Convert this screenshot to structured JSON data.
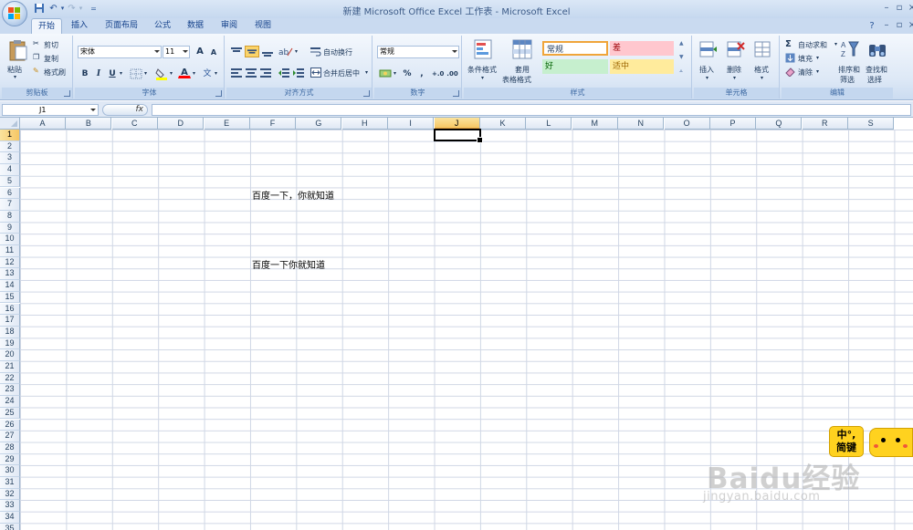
{
  "window": {
    "title": "新建 Microsoft Office Excel 工作表 - Microsoft Excel",
    "qat_customize_label": "="
  },
  "tabs": [
    "开始",
    "插入",
    "页面布局",
    "公式",
    "数据",
    "审阅",
    "视图"
  ],
  "ribbon": {
    "clipboard": {
      "label": "剪贴板",
      "paste": "粘贴",
      "cut": "剪切",
      "copy": "复制",
      "format_painter": "格式刷"
    },
    "font": {
      "label": "字体",
      "font_name": "宋体",
      "font_size": "11",
      "grow": "A",
      "shrink": "A",
      "bold": "B",
      "italic": "I",
      "underline": "U",
      "font_color_letter": "A",
      "phonetic": "文"
    },
    "alignment": {
      "label": "对齐方式",
      "wrap_text": "自动换行",
      "merge_center": "合并后居中"
    },
    "number": {
      "label": "数字",
      "format": "常规",
      "percent": "%",
      "comma": ",",
      "inc_decimal": "+.0",
      "dec_decimal": ".00"
    },
    "styles": {
      "label": "样式",
      "conditional_format": "条件格式",
      "format_table_1": "套用",
      "format_table_2": "表格格式",
      "normal": "常规",
      "bad": "差",
      "good": "好",
      "neutral": "适中",
      "normal_color": "#ffffff",
      "bad_color": "#ffc7ce",
      "good_color": "#c6efce",
      "neutral_color": "#ffeb9c"
    },
    "cells": {
      "label": "单元格",
      "insert": "插入",
      "delete": "删除",
      "format": "格式"
    },
    "editing": {
      "label": "编辑",
      "autosum": "自动求和",
      "fill": "填充",
      "clear": "清除",
      "sort_filter_1": "排序和",
      "sort_filter_2": "筛选",
      "find_select_1": "查找和",
      "find_select_2": "选择"
    }
  },
  "formula_bar": {
    "name_box": "J1",
    "fx": "fx",
    "content": ""
  },
  "sheet": {
    "columns": [
      "A",
      "B",
      "C",
      "D",
      "E",
      "F",
      "G",
      "H",
      "I",
      "J",
      "K",
      "L",
      "M",
      "N",
      "O",
      "P",
      "Q",
      "R",
      "S"
    ],
    "selected_column": "J",
    "rows": 35,
    "selected_row": 1,
    "cells": [
      {
        "ref": "F6",
        "value": "百度一下，你就知道"
      },
      {
        "ref": "F12",
        "value": "百度一下你就知道"
      }
    ]
  },
  "overlays": {
    "ime_line1": "中°,",
    "ime_line2": "简键",
    "watermark_main": "Baidu经验",
    "watermark_sub": "jingyan.baidu.com"
  }
}
